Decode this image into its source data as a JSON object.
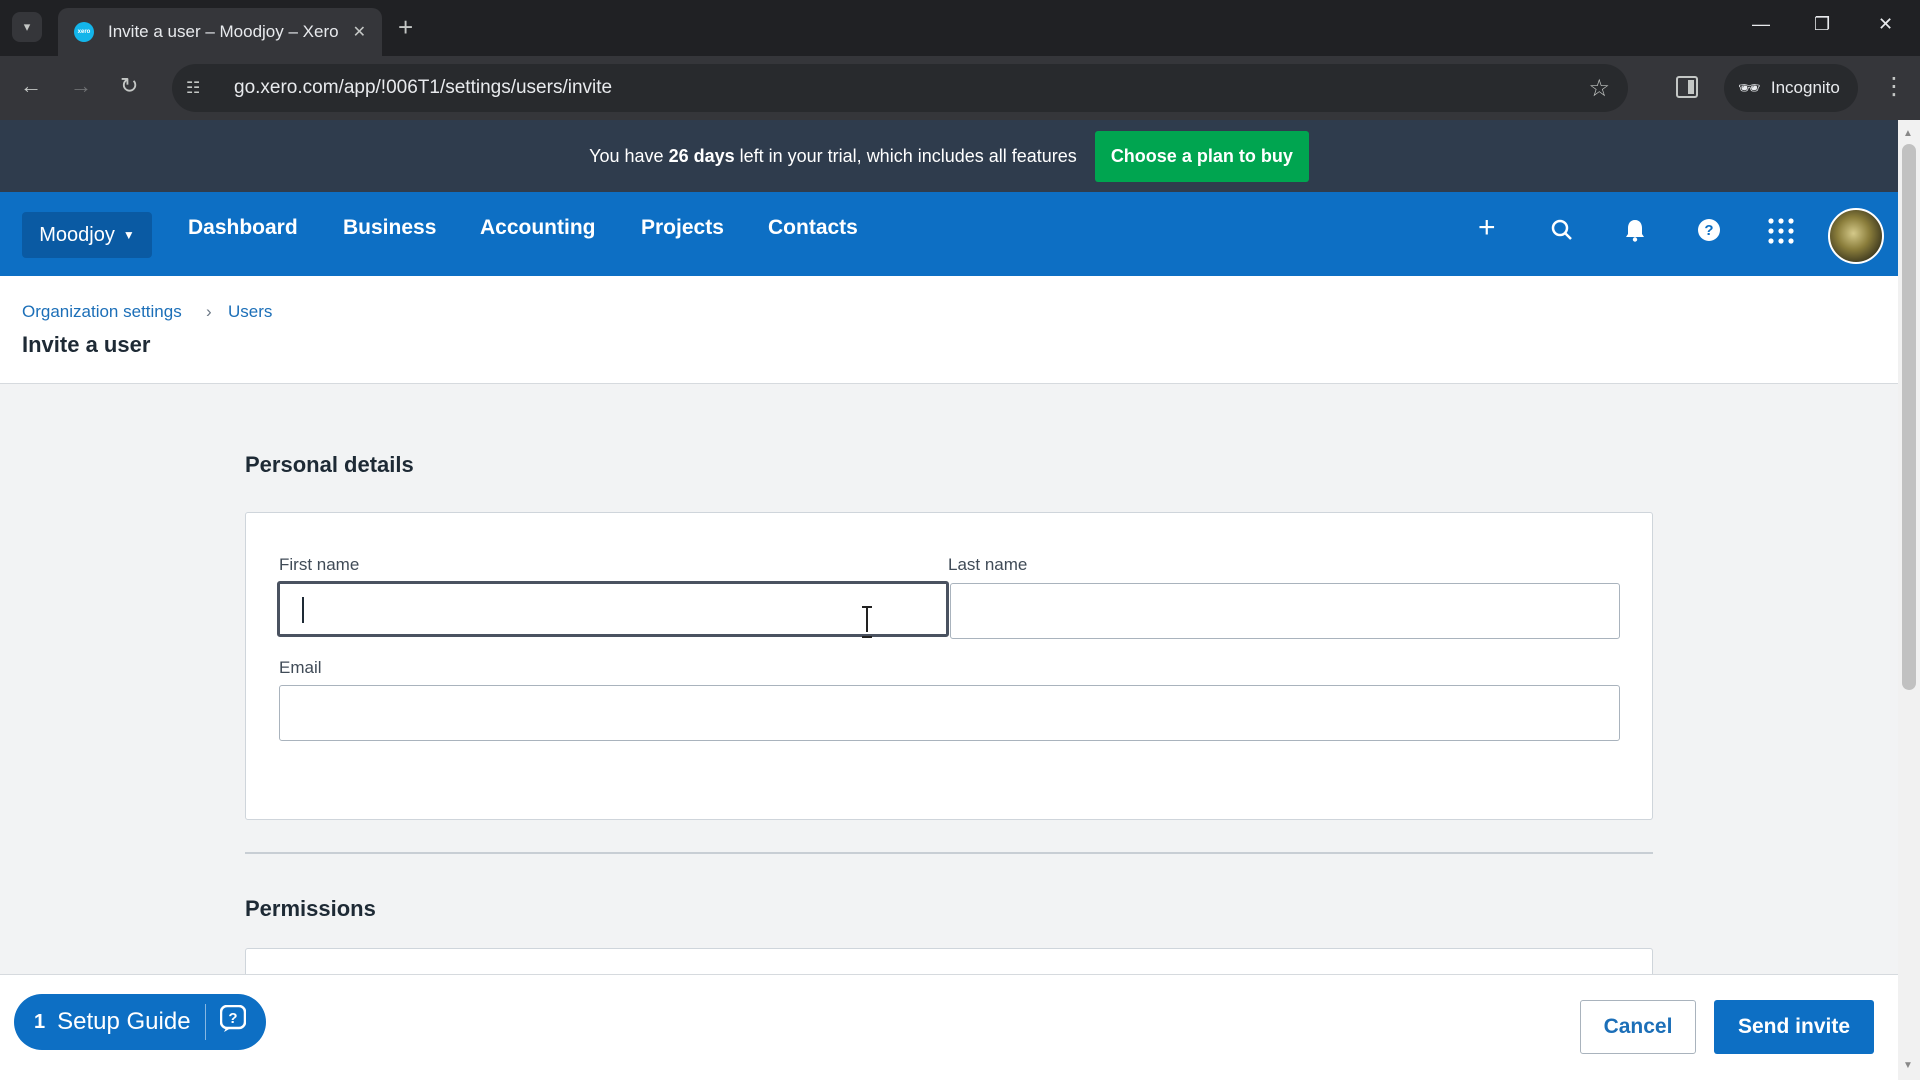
{
  "browser": {
    "tab_title": "Invite a user – Moodjoy – Xero",
    "favicon_text": "xero",
    "url": "go.xero.com/app/!006T1/settings/users/invite",
    "incognito_label": "Incognito",
    "icons": {
      "tab_list": "chevron-down-icon",
      "tab_close": "close-icon",
      "new_tab": "plus-icon",
      "back": "arrow-left-icon",
      "forward": "arrow-right-icon",
      "reload": "reload-icon",
      "site_info": "tune-icon",
      "bookmark": "star-icon",
      "menu": "kebab-icon"
    }
  },
  "trial_banner": {
    "text_before": "You have ",
    "days": "26 days",
    "text_after": " left in your trial, which includes all features",
    "cta": "Choose a plan to buy"
  },
  "nav": {
    "org": "Moodjoy",
    "items": [
      "Dashboard",
      "Business",
      "Accounting",
      "Projects",
      "Contacts"
    ],
    "icons": [
      "plus-icon",
      "search-icon",
      "bell-icon",
      "help-icon",
      "apps-grid-icon"
    ]
  },
  "breadcrumb": {
    "items": [
      "Organization settings",
      "Users"
    ],
    "separator": "›"
  },
  "page_title": "Invite a user",
  "personal_details": {
    "heading": "Personal details",
    "first_name": {
      "label": "First name",
      "value": ""
    },
    "last_name": {
      "label": "Last name",
      "value": ""
    },
    "email": {
      "label": "Email",
      "value": ""
    }
  },
  "permissions": {
    "heading": "Permissions"
  },
  "setup_guide": {
    "count": "1",
    "label": "Setup Guide"
  },
  "footer": {
    "cancel": "Cancel",
    "send": "Send invite"
  },
  "colors": {
    "brand_blue": "#0d6fc4",
    "banner_bg": "#2f3c4d",
    "cta_green": "#00a550",
    "link_blue": "#1c6fb8"
  }
}
